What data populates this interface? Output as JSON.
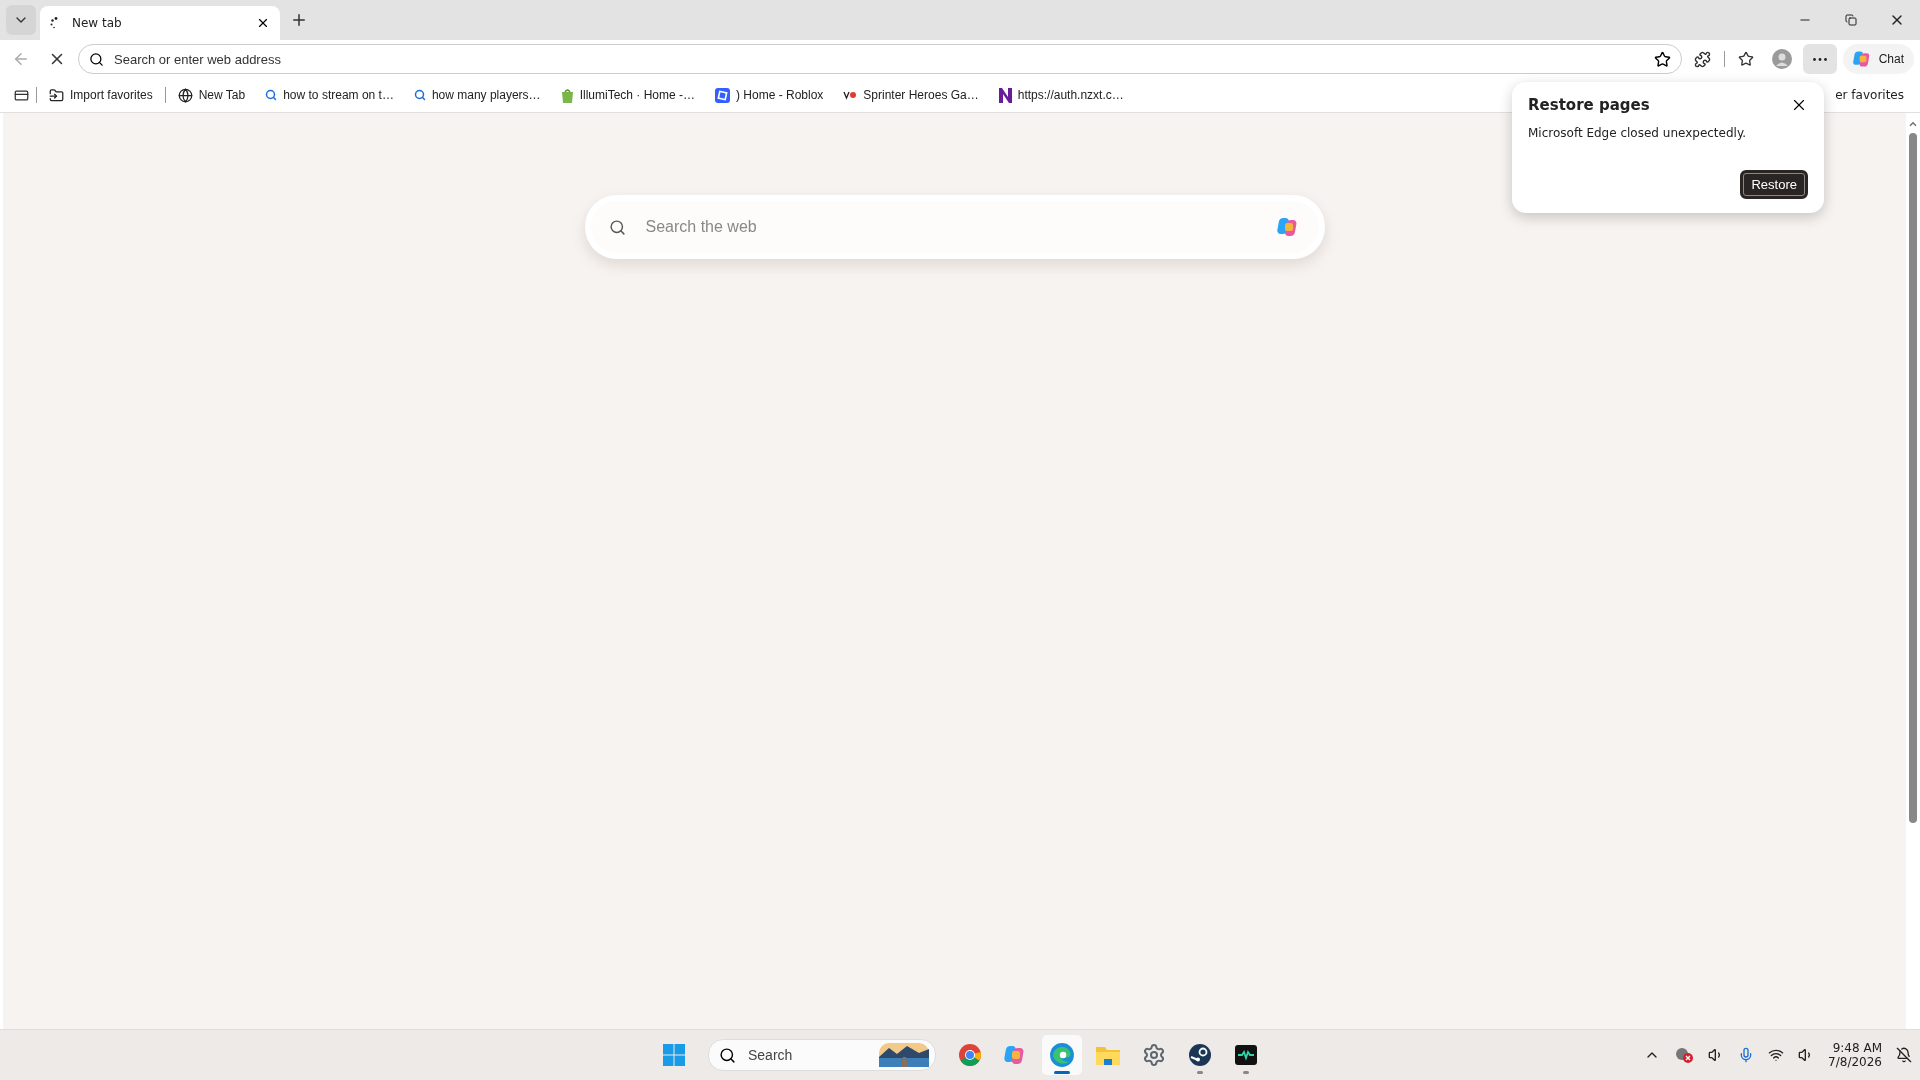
{
  "tabs": [
    {
      "label": "New tab",
      "selected": true
    }
  ],
  "address_bar": {
    "placeholder": "Search or enter web address"
  },
  "chat_button": {
    "label": "Chat"
  },
  "favorites_bar": {
    "items": [
      {
        "label": "Import favorites",
        "kind": "import"
      },
      {
        "label": "New Tab",
        "kind": "globe"
      },
      {
        "label": "how to stream on t…",
        "kind": "search"
      },
      {
        "label": "how many players…",
        "kind": "search"
      },
      {
        "label": "IllumiTech · Home -…",
        "kind": "shop"
      },
      {
        "label": ") Home - Roblox",
        "kind": "roblox"
      },
      {
        "label": "Sprinter Heroes Ga…",
        "kind": "vs"
      },
      {
        "label": "https://auth.nzxt.c…",
        "kind": "n"
      }
    ],
    "other_favorites": "er favorites"
  },
  "new_tab_search": {
    "placeholder": "Search the web"
  },
  "restore_popup": {
    "title": "Restore pages",
    "message": "Microsoft Edge closed unexpectedly.",
    "button": "Restore"
  },
  "taskbar": {
    "search_placeholder": "Search",
    "apps": [
      {
        "kind": "chrome",
        "active": false,
        "running": false
      },
      {
        "kind": "copilot",
        "active": false,
        "running": false
      },
      {
        "kind": "edge",
        "active": true,
        "running": true
      },
      {
        "kind": "explorer",
        "active": false,
        "running": false
      },
      {
        "kind": "settings",
        "active": false,
        "running": false
      },
      {
        "kind": "steam",
        "active": false,
        "running": true
      },
      {
        "kind": "monitor",
        "active": false,
        "running": true
      }
    ],
    "time": "9:48 AM",
    "date": "7/8/2026"
  }
}
